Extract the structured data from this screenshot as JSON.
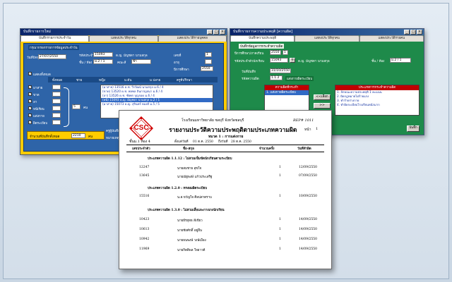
{
  "left": {
    "title": "บันทึกรายการใหม่",
    "tabs": [
      "บันทึกรายการประจำวัน",
      "แสดงประวัติทุกคน",
      "แสดงประวัติรายบุคคล"
    ],
    "section_title": "กรุณากรอกรายการข้อมูลประจำวัน",
    "date_label": "วันที่ปัจจุบัน",
    "date_value": "27/07/2550",
    "student_id_label": "รหัสประจำตัว",
    "student_id": "15093",
    "name_label": "ด.ญ. มัญชดา นามสกุล",
    "classroom_label": "ชั้น / ห้อง",
    "classroom": "ม.2 / 1",
    "house_label": "คณะสี",
    "house": "ฟ้า",
    "age_label": "อายุ",
    "year_label": "ปีการศึกษา",
    "year": "2550",
    "no_label": "เลขที่",
    "no": "1",
    "checks": [
      "มาสาย",
      "ขาด",
      "ลา",
      "หนีเรียน",
      "แต่งกาย",
      "ผิดระเบียบ"
    ],
    "check_all": "แสดงทั้งหมด",
    "radio_labels": [
      "ทั้งหมด",
      "ชาย",
      "หญิง",
      "ม.ต้น",
      "ม.ปลาย",
      "ครูที่ปรึกษา"
    ],
    "list_items": [
      "(มาสาย) 13516 ด.ช. วีรวัฒน์ นามสกุล ม.6 / 4",
      "(ขาด) 13520 ด.ช. พลพล ถิ่นกาญจนา ม.6 / 4",
      "(ลา) 13526 ด.ช. ชัยพร บุญรอด ม.6 / 4",
      "(หนี) 15093 ด.ญ. มัญชดา นามสกุล ม.2 / 1",
      "(มาสาย) 15073 ด.ญ. สุรินทร์ ทองดี ม.5 / 5"
    ],
    "count_label": "รวม",
    "count": "5",
    "total_label": "จำนวนที่บันทึกทั้งหมด",
    "total": "2210",
    "unit": "คน",
    "mini_labels": [
      "ครูผู้บันทึก",
      "หมายเหตุ"
    ]
  },
  "right": {
    "title": "บันทึกรายการความประพฤติ [ความผิด]",
    "tabs": [
      "บันทึกความประพฤติ",
      "แสดงประวัติทุกคน",
      "แสดงประวัติรายคน"
    ],
    "section_title": "บันทึกข้อมูลการกระทำความผิด",
    "year_label": "ปีการศึกษา/ภาคเรียน",
    "year": "2550",
    "term": "1",
    "id_label": "รหัสประจำตัวนักเรียน",
    "id_value": "15093",
    "name_value": "ด.ญ. มัญชดา นามสกุล",
    "class_label": "ชั้น / ห้อง",
    "class_value": "ม.2 / 1",
    "date_label": "วันที่บันทึก",
    "date_value": "31/10/2550",
    "code_label": "รหัสความผิด",
    "code_value": "1.1.2",
    "code_desc": "แต่งกายผิดระเบียบ",
    "left_list_header": "ความผิดที่กระทำ",
    "left_list": [
      "1. แต่งกายผิดระเบียบ"
    ],
    "right_list_header": "ประเภทการกระทำความผิด",
    "right_list": [
      "1. ลักษณะความประพฤติ 1 คะแนน",
      "2. ผิดกฎหมายไม่ร้ายแรง",
      "3. ทำร้ายร่างกาย",
      "4. ทำผิดระเบียบโรงเรียนหนักมาก"
    ],
    "btn_back": "<<เลือก",
    "btn_forward": ">>",
    "btn_save": "บันทึก"
  },
  "report": {
    "logo_text": "CSC",
    "school": "โรงเรียนมหาวิทยาลัย ชลบุรี จังหวัดชลบุรี",
    "title": "รายงานประวัติความประพฤติตามประเภทความผิด",
    "report_code": "REP# 1011",
    "page_label": "หน้า",
    "page": "1",
    "class_line": "ชั้นม.1 ห้อง 4",
    "section_line": "หมวด 1 : การแต่งกาย",
    "range_label": "ตั้งแต่วันที่",
    "range_from": "01 ต.ค. 2550",
    "range_to_label": "ถึงวันที่",
    "range_to": "28 ต.ค. 2550",
    "columns": [
      "เลขประจำตัว",
      "ชื่อ-สกุล",
      "จำนวนครั้ง",
      "วันที่ทำผิด"
    ],
    "groups": [
      {
        "label": "ประเภทความผิด 1.1.12 : ไม่สวมเข็มขัดนักเรียนตามระเบียบ",
        "rows": [
          {
            "id": "12247",
            "name": "นายสมชาย สุขใจ",
            "count": "1",
            "date": "12/09/2550"
          },
          {
            "id": "13645",
            "name": "นายณัฐพงษ์ แก้วประเสริฐ",
            "count": "1",
            "date": "07/09/2550"
          }
        ]
      },
      {
        "label": "ประเภทความผิด 1.2.0 : ทรงผมผิดระเบียบ",
        "rows": [
          {
            "id": "15516",
            "name": "น.ส.ขวัญใจ ศิลปสาตราบ",
            "count": "1",
            "date": "10/09/2550"
          }
        ]
      },
      {
        "label": "ประเภทความผิด 1.3.0 : ไม่สวมเสื้อและกางเกงนักเรียน",
        "rows": [
          {
            "id": "10423",
            "name": "นายธีรยุทธ สีเขียว",
            "count": "1",
            "date": "14/09/2550"
          },
          {
            "id": "10613",
            "name": "นายชัยศักดิ์ อยู่ยืน",
            "count": "1",
            "date": "14/09/2550"
          },
          {
            "id": "10942",
            "name": "นายธนพงษ์ วงษ์เมือง",
            "count": "1",
            "date": "14/09/2550"
          },
          {
            "id": "11969",
            "name": "นายกิตติพล ใจยาวดี",
            "count": "1",
            "date": "14/09/2550"
          }
        ]
      }
    ]
  },
  "colors": {
    "left_body": "#ffcc00",
    "left_inner": "#2e64a8",
    "right_body": "#1e8a4a",
    "titlebar": "#0a246a",
    "logo_red": "#d00000"
  }
}
